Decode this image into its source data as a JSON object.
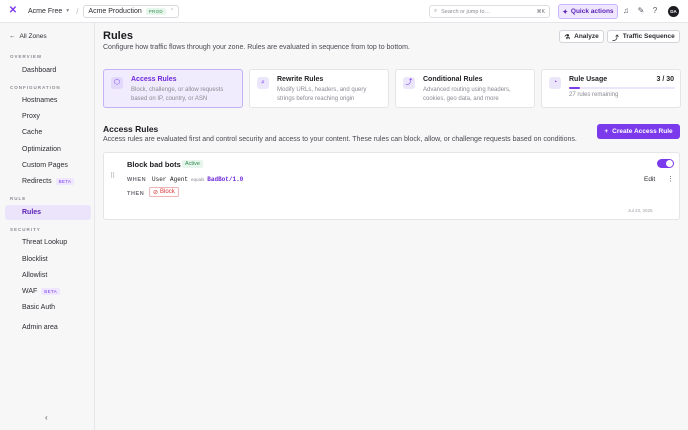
{
  "topbar": {
    "logo": "✕",
    "org": "Acme Free",
    "zone": "Acme Production",
    "zone_badge": "PROD",
    "search_placeholder": "Search or jump to…",
    "search_shortcut": "⌘K",
    "quick_actions": "Quick actions",
    "avatar": "DA"
  },
  "sidebar": {
    "back": "All Zones",
    "sections": {
      "overview": "OVERVIEW",
      "configuration": "CONFIGURATION",
      "rule": "RULE",
      "security": "SECURITY"
    },
    "items": {
      "dashboard": "Dashboard",
      "hostnames": "Hostnames",
      "proxy": "Proxy",
      "cache": "Cache",
      "optimization": "Optimization",
      "custom_pages": "Custom Pages",
      "redirects": "Redirects",
      "rules": "Rules",
      "threat_lookup": "Threat Lookup",
      "blocklist": "Blocklist",
      "allowlist": "Allowlist",
      "waf": "WAF",
      "basic_auth": "Basic Auth",
      "admin_area": "Admin area"
    },
    "beta": "BETA",
    "collapse": "‹"
  },
  "header": {
    "title": "Rules",
    "subtitle": "Configure how traffic flows through your zone. Rules are evaluated in sequence from top to bottom.",
    "analyze": "Analyze",
    "traffic_sequence": "Traffic Sequence"
  },
  "cards": [
    {
      "title": "Access Rules",
      "desc": "Block, challenge, or allow requests based on IP, country, or ASN",
      "icon": "⬡"
    },
    {
      "title": "Rewrite Rules",
      "desc": "Modify URLs, headers, and query strings before reaching origin",
      "icon": "⌕"
    },
    {
      "title": "Conditional Rules",
      "desc": "Advanced routing using headers, cookies, geo data, and more",
      "icon": "⤴"
    }
  ],
  "usage": {
    "title": "Rule Usage",
    "count": "3 / 30",
    "remaining": "27 rules remaining",
    "used": 3,
    "limit": 30,
    "icon": "◔"
  },
  "access_rules": {
    "title": "Access Rules",
    "desc": "Access rules are evaluated first and control security and access to your content. These rules can block, allow, or challenge requests based on conditions.",
    "create_button": "Create Access Rule"
  },
  "rule": {
    "name": "Block bad bots",
    "status": "Active",
    "when_label": "WHEN",
    "field": "User Agent",
    "operator": "equals",
    "value": "BadBot/1.0",
    "then_label": "THEN",
    "action": "Block",
    "edit": "Edit",
    "date": "Jul 23, 2026",
    "enabled": true
  },
  "colors": {
    "accent": "#7c3aed",
    "accent_light": "#efe7ff",
    "danger": "#d93434",
    "success": "#2e8b4d"
  }
}
